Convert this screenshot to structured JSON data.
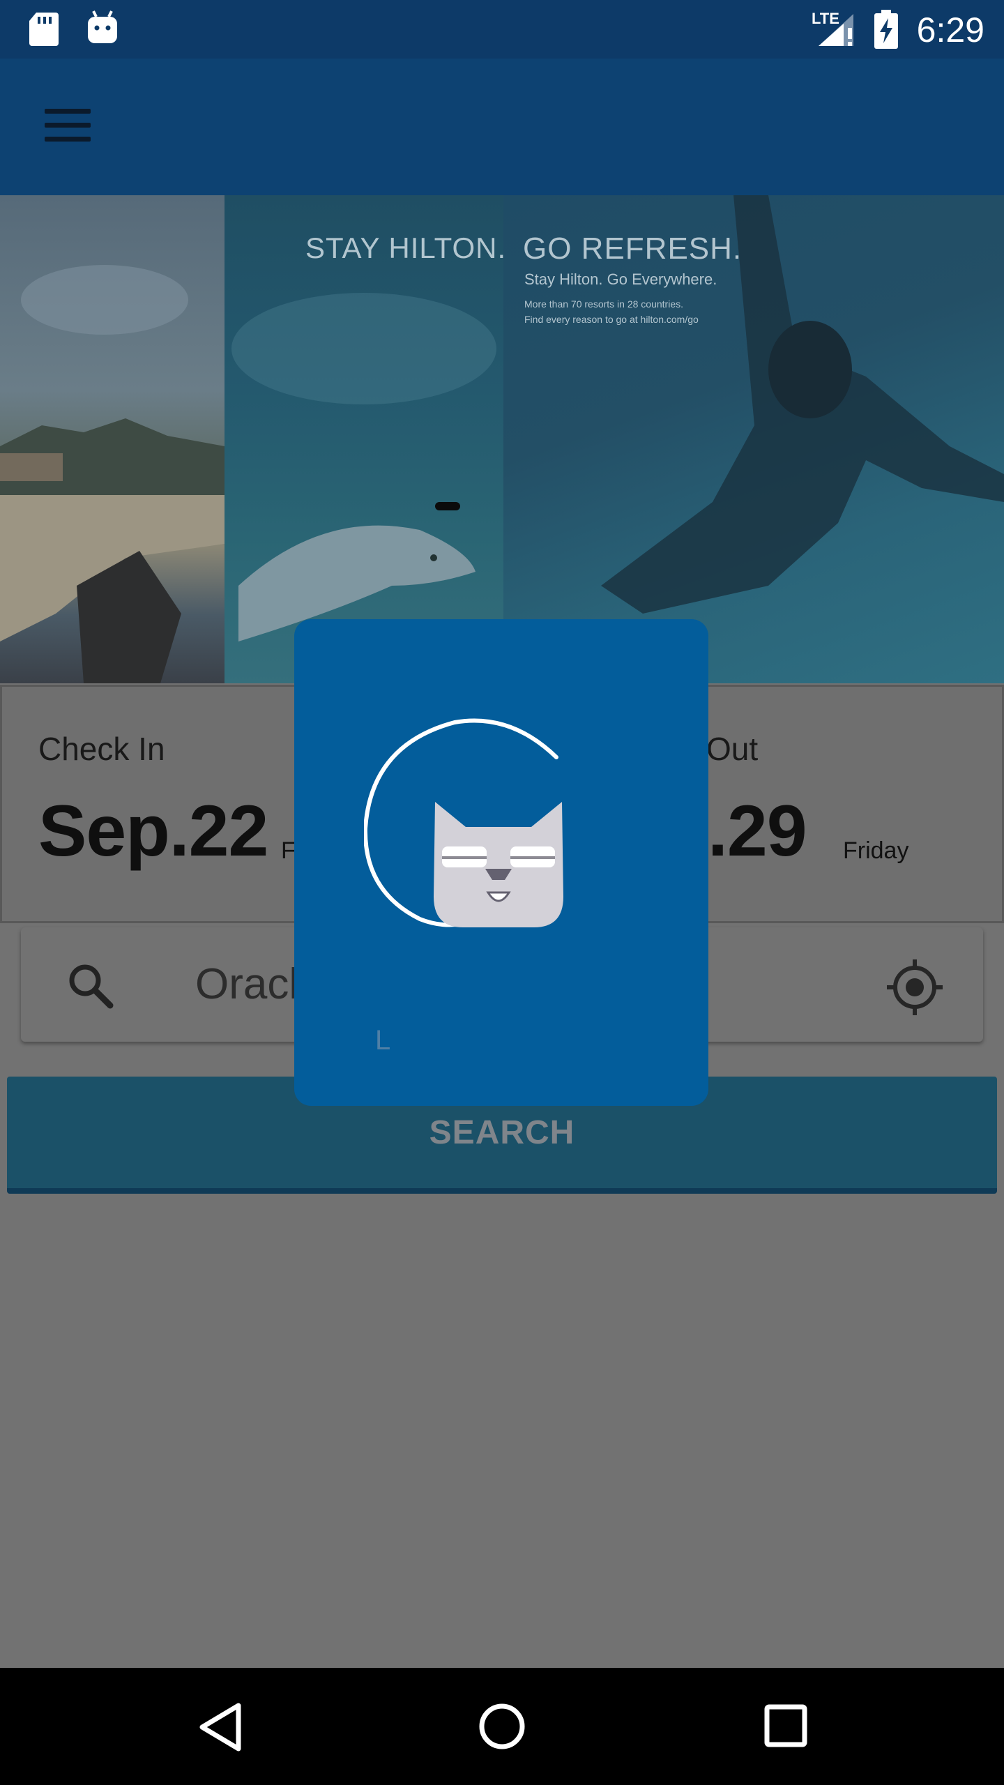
{
  "status_bar": {
    "time": "6:29",
    "network": "LTE",
    "icons": [
      "sd-card-icon",
      "android-icon",
      "signal-icon",
      "battery-charging-icon"
    ]
  },
  "toolbar": {
    "menu_icon": "hamburger-menu-icon"
  },
  "hero": {
    "stay_text": "STAY HILTON.",
    "go_text": "GO REFRESH.",
    "tagline": "Stay Hilton. Go Everywhere.",
    "small_line1": "More than 70 resorts in 28 countries.",
    "small_line2": "Find every reason to go at hilton.com/go"
  },
  "dates": {
    "check_in_label": "Check In",
    "check_in_date": "Sep.22",
    "check_in_day": "F",
    "check_out_label": "Out",
    "check_out_date": ".29",
    "check_out_day": "Friday"
  },
  "search": {
    "value": "Oracl",
    "button_label": "SEARCH",
    "search_icon": "search-icon",
    "location_icon": "my-location-icon"
  },
  "loading": {
    "text": "L",
    "mascot": "cat-mascot-icon"
  },
  "nav_bar": {
    "icons": [
      "back-icon",
      "home-icon",
      "recents-icon"
    ]
  },
  "colors": {
    "status_bar": "#0d3a68",
    "toolbar": "#0d4272",
    "dialog": "#035d9b",
    "scrim": "#727272",
    "search_button": "#1b5168"
  }
}
